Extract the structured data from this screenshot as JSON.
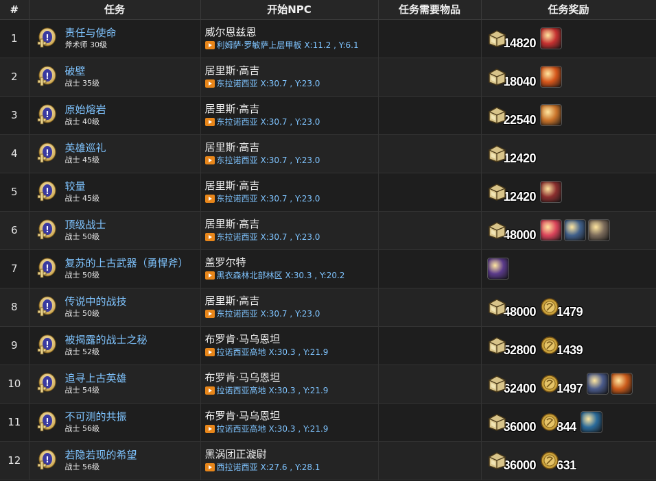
{
  "headers": {
    "num": "#",
    "quest": "任务",
    "npc": "开始NPC",
    "items": "任务需要物品",
    "rewards": "任务奖励"
  },
  "rows": [
    {
      "num": "1",
      "name": "责任与使命",
      "level": "斧术师 30级",
      "npc": "威尔恩兹恩",
      "place": "利姆萨·罗敏萨上层甲板",
      "coord": "X:11.2 , Y:6.1",
      "gil": "14820",
      "mgp": null,
      "items": [
        {
          "icon": "heart-item-icon",
          "color": "#c43030"
        }
      ]
    },
    {
      "num": "2",
      "name": "破壁",
      "level": "战士 35级",
      "npc": "居里斯·高吉",
      "place": "东拉诺西亚",
      "coord": "X:30.7 , Y:23.0",
      "gil": "18040",
      "mgp": null,
      "items": [
        {
          "icon": "fire-action-icon",
          "color": "#d4551a"
        }
      ]
    },
    {
      "num": "3",
      "name": "原始熔岩",
      "level": "战士 40级",
      "npc": "居里斯·高吉",
      "place": "东拉诺西亚",
      "coord": "X:30.7 , Y:23.0",
      "gil": "22540",
      "mgp": null,
      "items": [
        {
          "icon": "axe-action-icon",
          "color": "#c9732a"
        }
      ]
    },
    {
      "num": "4",
      "name": "英雄巡礼",
      "level": "战士 45级",
      "npc": "居里斯·高吉",
      "place": "东拉诺西亚",
      "coord": "X:30.7 , Y:23.0",
      "gil": "12420",
      "mgp": null,
      "items": []
    },
    {
      "num": "5",
      "name": "较量",
      "level": "战士 45级",
      "npc": "居里斯·高吉",
      "place": "东拉诺西亚",
      "coord": "X:30.7 , Y:23.0",
      "gil": "12420",
      "mgp": null,
      "items": [
        {
          "icon": "slash-action-icon",
          "color": "#8a2e2e"
        }
      ]
    },
    {
      "num": "6",
      "name": "顶级战士",
      "level": "战士 50级",
      "npc": "居里斯·高吉",
      "place": "东拉诺西亚",
      "coord": "X:30.7 , Y:23.0",
      "gil": "48000",
      "mgp": null,
      "items": [
        {
          "icon": "burst-action-icon",
          "color": "#d9435a"
        },
        {
          "icon": "armor-item-icon",
          "color": "#3f5f8a"
        },
        {
          "icon": "gauntlet-item-icon",
          "color": "#7a6a5a"
        }
      ]
    },
    {
      "num": "7",
      "name": "复苏的上古武器（勇悍斧）",
      "level": "战士 50级",
      "npc": "盖罗尔特",
      "place": "黑衣森林北部林区",
      "coord": "X:30.3 , Y:20.2",
      "gil": null,
      "mgp": null,
      "items": [
        {
          "icon": "axe-weapon-icon",
          "color": "#5a3a8a"
        }
      ]
    },
    {
      "num": "8",
      "name": "传说中的战技",
      "level": "战士 50级",
      "npc": "居里斯·高吉",
      "place": "东拉诺西亚",
      "coord": "X:30.7 , Y:23.0",
      "gil": "48000",
      "mgp": "1479",
      "items": []
    },
    {
      "num": "9",
      "name": "被揭露的战士之秘",
      "level": "战士 52级",
      "npc": "布罗肯·马乌恩坦",
      "place": "拉诺西亚高地",
      "coord": "X:30.3 , Y:21.9",
      "gil": "52800",
      "mgp": "1439",
      "items": []
    },
    {
      "num": "10",
      "name": "追寻上古英雄",
      "level": "战士 54级",
      "npc": "布罗肯·马乌恩坦",
      "place": "拉诺西亚高地",
      "coord": "X:30.3 , Y:21.9",
      "gil": "62400",
      "mgp": "1497",
      "items": [
        {
          "icon": "whirl-action-icon",
          "color": "#4a5a8a"
        },
        {
          "icon": "rage-action-icon",
          "color": "#c95a1a"
        }
      ]
    },
    {
      "num": "11",
      "name": "不可测的共振",
      "level": "战士 56级",
      "npc": "布罗肯·马乌恩坦",
      "place": "拉诺西亚高地",
      "coord": "X:30.3 , Y:21.9",
      "gil": "36000",
      "mgp": "844",
      "items": [
        {
          "icon": "strike-action-icon",
          "color": "#2a6a9a"
        }
      ]
    },
    {
      "num": "12",
      "name": "若隐若现的希望",
      "level": "战士 56级",
      "npc": "黑涡团正漩尉",
      "place": "西拉诺西亚",
      "coord": "X:27.6 , Y:28.1",
      "gil": "36000",
      "mgp": "631",
      "items": []
    }
  ]
}
